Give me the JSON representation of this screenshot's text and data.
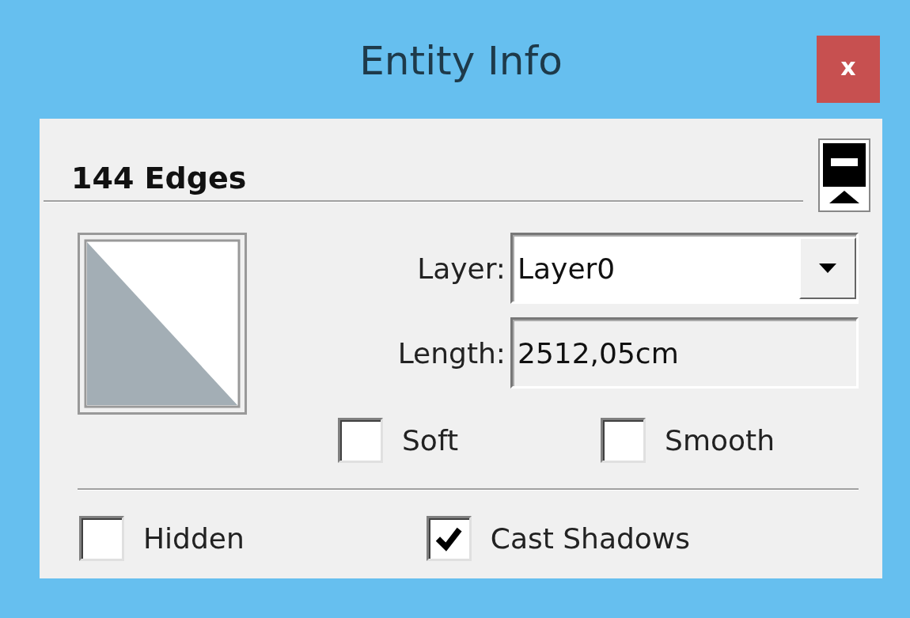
{
  "window": {
    "title": "Entity Info",
    "close": "x"
  },
  "selection": {
    "title": "144 Edges"
  },
  "fields": [
    {
      "kind": "dropdown",
      "label": "Layer:",
      "value": "Layer0"
    },
    {
      "kind": "readonly",
      "label": "Length:",
      "value": "2512,05cm"
    }
  ],
  "edge_options": [
    {
      "label": "Soft",
      "checked": false
    },
    {
      "label": "Smooth",
      "checked": false
    }
  ],
  "options": [
    {
      "label": "Hidden",
      "checked": false
    },
    {
      "label": "Cast Shadows",
      "checked": true
    }
  ]
}
